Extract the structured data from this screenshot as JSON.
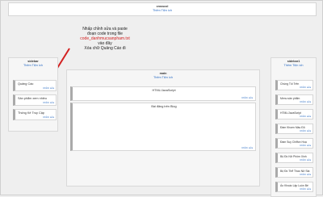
{
  "crosscol": {
    "title": "crosscol",
    "add": "Thêm Tiện ích"
  },
  "annotation": {
    "line1": "Nhấp chỉnh sửa và paste",
    "line2": "đoạn code trong file",
    "line3": "code_danhmucsanpham.txt",
    "line4": "vào đây",
    "line5": "Xóa chữ Quảng Cáo đi"
  },
  "sidebar": {
    "title": "sidebar",
    "add": "Thêm Tiện ích",
    "gadgets": [
      {
        "name": "Quảng Cáo",
        "edit": "Chỉnh sửa"
      },
      {
        "name": "Sản phẩm xem nhiều",
        "edit": "Chỉnh sửa"
      },
      {
        "name": "Thống Kê Truy Cập",
        "edit": "Chỉnh sửa"
      }
    ]
  },
  "main": {
    "title": "main",
    "add": "Thêm Tiện ích",
    "gadgets": [
      {
        "name": "HTML/JavaScript",
        "edit": "Chỉnh sửa"
      },
      {
        "name": "Bài đăng trên Blog",
        "edit": "Chỉnh sửa"
      }
    ]
  },
  "sidebar1": {
    "title": "sidebar1",
    "add": "Thêm Tiện ích",
    "gadgets": [
      {
        "name": "Chúng Tôi Trên",
        "edit": "Chỉnh sửa"
      },
      {
        "name": "Menu sản phẩm",
        "edit": "Chỉnh sửa"
      },
      {
        "name": "HTML/JavaScript",
        "edit": "Chỉnh sửa"
      },
      {
        "name": "Đầm Khoen Màu Đỏ",
        "edit": "Chỉnh sửa"
      },
      {
        "name": "Đầm Suy Chiffon Hoạ",
        "edit": "Chỉnh sửa"
      },
      {
        "name": "Bộ Đồ Nữ Phôm Xinh",
        "edit": "Chỉnh sửa"
      },
      {
        "name": "Bộ Đồ Thể Thao Nữ Sta",
        "edit": "Chỉnh sửa"
      },
      {
        "name": "Áo Khoác Lập Luồn Bé",
        "edit": "Chỉnh sửa"
      }
    ]
  },
  "colors": {
    "link": "#2a6cc4",
    "arrow": "#d32020"
  }
}
